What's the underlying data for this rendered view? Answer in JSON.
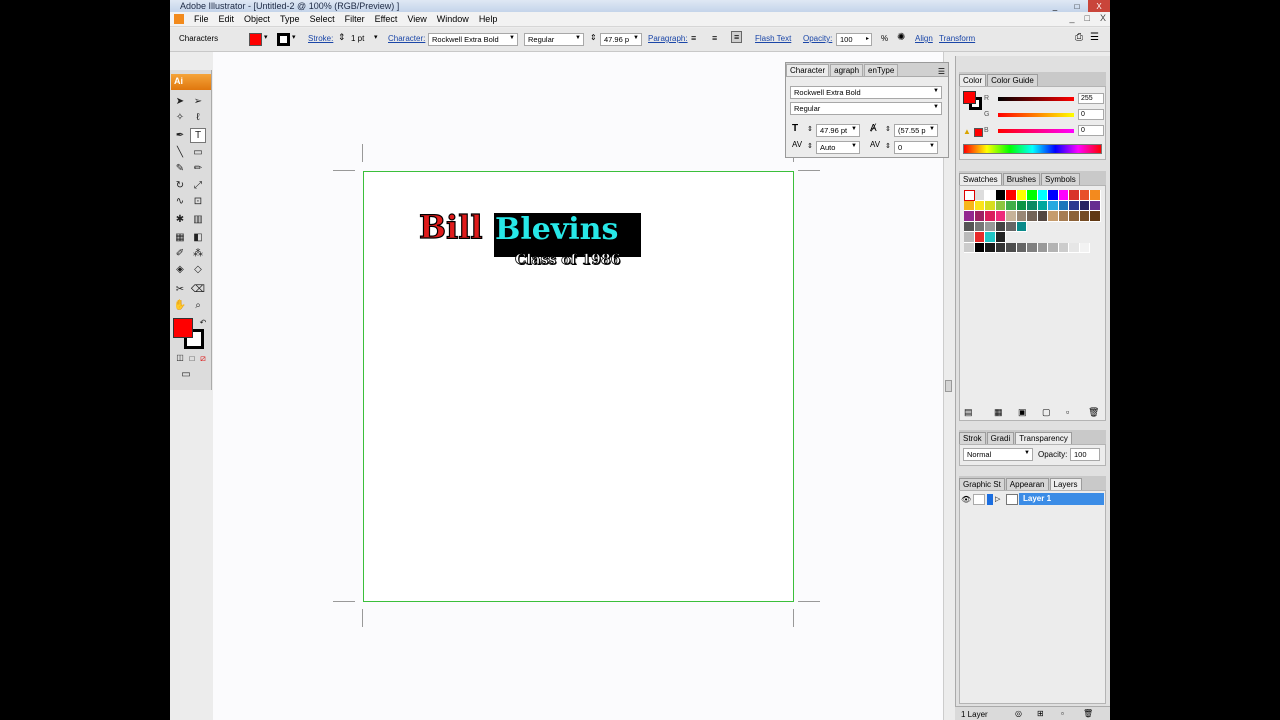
{
  "window": {
    "title": "Adobe Illustrator - [Untitled-2 @ 100% (RGB/Preview) ]",
    "controls": [
      "_",
      "□",
      "X"
    ]
  },
  "menu": {
    "items": [
      "File",
      "Edit",
      "Object",
      "Type",
      "Select",
      "Filter",
      "Effect",
      "View",
      "Window",
      "Help"
    ],
    "doc_controls": [
      "_",
      "□",
      "X"
    ]
  },
  "control_bar": {
    "mode_label": "Characters",
    "fill_color": "#ff0000",
    "stroke_color": "#000000",
    "stroke_label": "Stroke:",
    "stroke_value": "1 pt",
    "character_label": "Character:",
    "font_family": "Rockwell Extra Bold",
    "font_style": "Regular",
    "font_size": "47.96 p",
    "paragraph_label": "Paragraph:",
    "flash_text_label": "Flash Text",
    "opacity_label": "Opacity:",
    "opacity_value": "100",
    "opacity_unit": "%",
    "align_label": "Align",
    "transform_label": "Transform"
  },
  "toolbox": {
    "logo": "Ai",
    "fill_color": "#ff0000",
    "stroke_color": "#000000"
  },
  "artwork": {
    "name_first": "Bill",
    "name_last": "Blevins",
    "subtitle": "Class of 1986",
    "first_color": "#e01b1b",
    "last_color": "#27e8e8"
  },
  "character_panel": {
    "tabs": [
      "Character",
      "agraph",
      "enType"
    ],
    "font_family": "Rockwell Extra Bold",
    "font_style": "Regular",
    "size_value": "47.96 pt",
    "leading_value": "(57.55 p",
    "kerning_value": "Auto",
    "tracking_value": "0"
  },
  "color_panel": {
    "tabs": [
      "Color",
      "Color Guide"
    ],
    "r_label": "R",
    "r_value": "255",
    "g_label": "G",
    "g_value": "0",
    "b_label": "B",
    "b_value": "0"
  },
  "swatches_panel": {
    "tabs": [
      "Swatches",
      "Brushes",
      "Symbols"
    ]
  },
  "transparency_panel": {
    "tabs": [
      "Strok",
      "Gradi",
      "Transparency"
    ],
    "blend_mode": "Normal",
    "opacity_label": "Opacity:",
    "opacity_value": "100"
  },
  "layers_panel": {
    "tabs": [
      "Graphic St",
      "Appearan",
      "Layers"
    ],
    "layer_name": "Layer 1",
    "footer_count": "1 Layer"
  }
}
